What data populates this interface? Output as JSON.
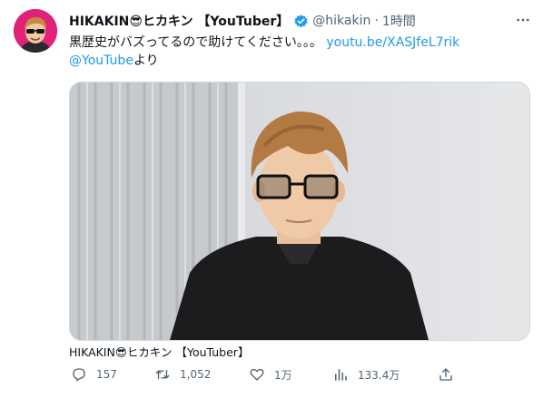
{
  "tweet": {
    "author_name": "HIKAKIN😎ヒカキン 【YouTuber】",
    "handle": "@hikakin",
    "separator": "·",
    "time": "1時間",
    "text_main": "黒歴史がバズってるので助けてください。。。",
    "text_link": "youtu.be/XASJfeL7rik",
    "text_mention": "@YouTube",
    "text_suffix": "より",
    "media_caption": "HIKAKIN😎ヒカキン 【YouTuber】",
    "icons": {
      "more": "more-icon",
      "verified": "verified-badge-icon",
      "reply": "reply-icon",
      "retweet": "retweet-icon",
      "like": "like-icon",
      "views": "views-icon",
      "share": "share-icon"
    },
    "colors": {
      "link": "#1d9bf0",
      "secondary_text": "#536471",
      "avatar_bg": "#e0227a"
    }
  },
  "actions": {
    "reply_count": "157",
    "retweet_count": "1,052",
    "like_count": "1万",
    "views_count": "133.4万"
  }
}
